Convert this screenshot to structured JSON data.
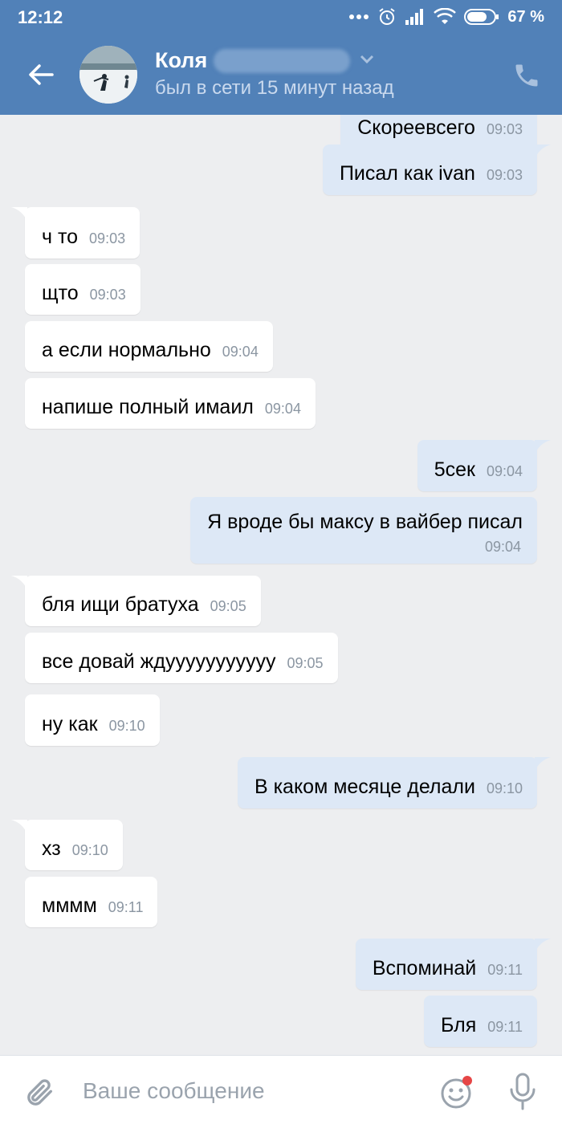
{
  "status_bar": {
    "time": "12:12",
    "battery": "67 %"
  },
  "header": {
    "contact_name": "Коля",
    "presence": "был в сети 15 минут назад"
  },
  "messages": [
    {
      "dir": "out",
      "text": "Скореевсего",
      "time": "09:03"
    },
    {
      "dir": "out",
      "text": "Писал как ivan",
      "time": "09:03"
    },
    {
      "dir": "in",
      "text": "ч то",
      "time": "09:03"
    },
    {
      "dir": "in",
      "text": "щто",
      "time": "09:03"
    },
    {
      "dir": "in",
      "text": "а если нормально",
      "time": "09:04"
    },
    {
      "dir": "in",
      "text": "напише полный имаил",
      "time": "09:04"
    },
    {
      "dir": "out",
      "text": "5сек",
      "time": "09:04"
    },
    {
      "dir": "out",
      "text": "Я вроде бы максу в вайбер писал",
      "time": "09:04"
    },
    {
      "dir": "in",
      "text": "бля ищи братуха",
      "time": "09:05"
    },
    {
      "dir": "in",
      "text": "все довай ждууууууууууу",
      "time": "09:05"
    },
    {
      "dir": "in",
      "text": "ну как",
      "time": "09:10"
    },
    {
      "dir": "out",
      "text": "В каком месяце делали",
      "time": "09:10"
    },
    {
      "dir": "in",
      "text": "хз",
      "time": "09:10"
    },
    {
      "dir": "in",
      "text": "мммм",
      "time": "09:11"
    },
    {
      "dir": "out",
      "text": "Вспоминай",
      "time": "09:11"
    },
    {
      "dir": "out",
      "text": "Бля",
      "time": "09:11"
    }
  ],
  "composer": {
    "placeholder": "Ваше сообщение"
  },
  "colors": {
    "header": "#5181b8",
    "incoming": "#ffffff",
    "outgoing": "#dde8f6",
    "background": "#edeef0",
    "badge": "#e64646"
  },
  "icons": [
    "back-arrow-icon",
    "phone-icon",
    "chevron-down-icon",
    "paperclip-icon",
    "emoji-icon",
    "microphone-icon"
  ]
}
